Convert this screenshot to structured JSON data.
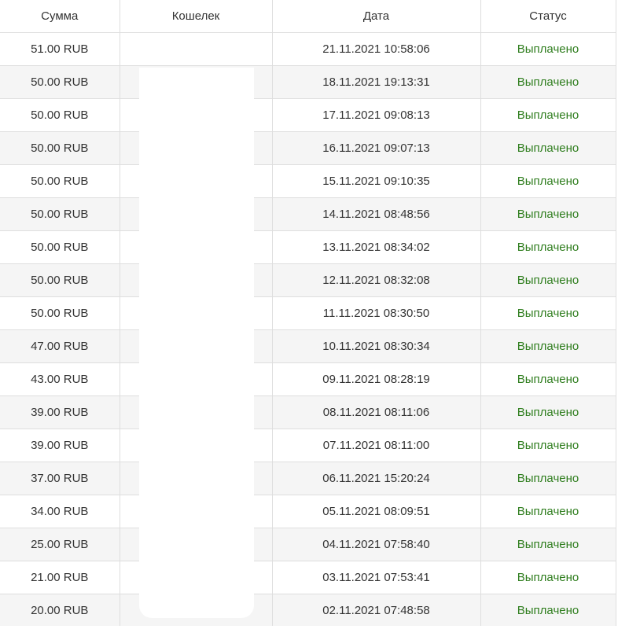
{
  "table": {
    "headers": {
      "amount": "Сумма",
      "wallet": "Кошелек",
      "date": "Дата",
      "status": "Статус"
    },
    "status_color": "#2e7d1d",
    "rows": [
      {
        "amount": "51.00 RUB",
        "wallet": "",
        "date": "21.11.2021 10:58:06",
        "status": "Выплачено"
      },
      {
        "amount": "50.00 RUB",
        "wallet": "",
        "date": "18.11.2021 19:13:31",
        "status": "Выплачено"
      },
      {
        "amount": "50.00 RUB",
        "wallet": "",
        "date": "17.11.2021 09:08:13",
        "status": "Выплачено"
      },
      {
        "amount": "50.00 RUB",
        "wallet": "",
        "date": "16.11.2021 09:07:13",
        "status": "Выплачено"
      },
      {
        "amount": "50.00 RUB",
        "wallet": "",
        "date": "15.11.2021 09:10:35",
        "status": "Выплачено"
      },
      {
        "amount": "50.00 RUB",
        "wallet": "",
        "date": "14.11.2021 08:48:56",
        "status": "Выплачено"
      },
      {
        "amount": "50.00 RUB",
        "wallet": "",
        "date": "13.11.2021 08:34:02",
        "status": "Выплачено"
      },
      {
        "amount": "50.00 RUB",
        "wallet": "",
        "date": "12.11.2021 08:32:08",
        "status": "Выплачено"
      },
      {
        "amount": "50.00 RUB",
        "wallet": "",
        "date": "11.11.2021 08:30:50",
        "status": "Выплачено"
      },
      {
        "amount": "47.00 RUB",
        "wallet": "",
        "date": "10.11.2021 08:30:34",
        "status": "Выплачено"
      },
      {
        "amount": "43.00 RUB",
        "wallet": "",
        "date": "09.11.2021 08:28:19",
        "status": "Выплачено"
      },
      {
        "amount": "39.00 RUB",
        "wallet": "",
        "date": "08.11.2021 08:11:06",
        "status": "Выплачено"
      },
      {
        "amount": "39.00 RUB",
        "wallet": "",
        "date": "07.11.2021 08:11:00",
        "status": "Выплачено"
      },
      {
        "amount": "37.00 RUB",
        "wallet": "",
        "date": "06.11.2021 15:20:24",
        "status": "Выплачено"
      },
      {
        "amount": "34.00 RUB",
        "wallet": "",
        "date": "05.11.2021 08:09:51",
        "status": "Выплачено"
      },
      {
        "amount": "25.00 RUB",
        "wallet": "",
        "date": "04.11.2021 07:58:40",
        "status": "Выплачено"
      },
      {
        "amount": "21.00 RUB",
        "wallet": "",
        "date": "03.11.2021 07:53:41",
        "status": "Выплачено"
      },
      {
        "amount": "20.00 RUB",
        "wallet": "",
        "date": "02.11.2021 07:48:58",
        "status": "Выплачено"
      }
    ]
  }
}
